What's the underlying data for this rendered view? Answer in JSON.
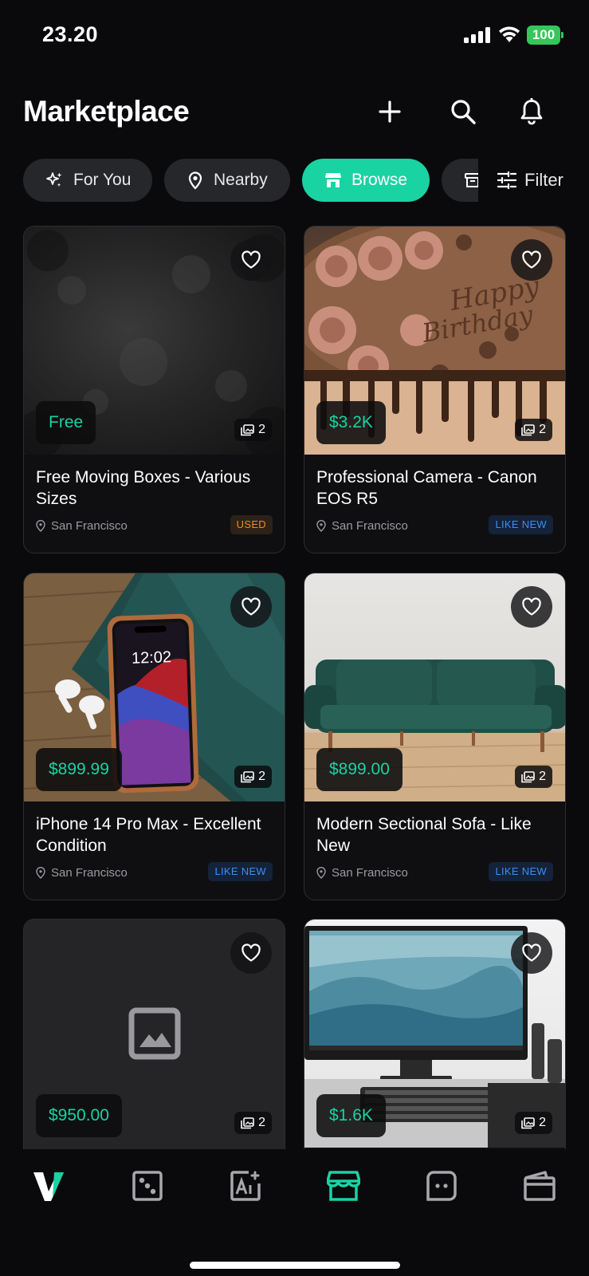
{
  "status_bar": {
    "time": "23.20",
    "battery": "100"
  },
  "header": {
    "title": "Marketplace"
  },
  "chips": [
    {
      "label": "For You",
      "icon": "sparkle-icon",
      "active": false
    },
    {
      "label": "Nearby",
      "icon": "location-pin-icon",
      "active": false
    },
    {
      "label": "Browse",
      "icon": "store-icon",
      "active": true
    }
  ],
  "filter": {
    "label": "Filter"
  },
  "listings": [
    {
      "price": "Free",
      "title": "Free Moving Boxes - Various Sizes",
      "location": "San Francisco",
      "condition": "USED",
      "image_count": "2",
      "image": "dark-texture"
    },
    {
      "price": "$3.2K",
      "title": "Professional Camera - Canon EOS R5",
      "location": "San Francisco",
      "condition": "LIKE NEW",
      "image_count": "2",
      "image": "birthday-cake"
    },
    {
      "price": "$899.99",
      "title": "iPhone 14 Pro Max - Excellent Condition",
      "location": "San Francisco",
      "condition": "LIKE NEW",
      "image_count": "2",
      "image": "iphone-on-table"
    },
    {
      "price": "$899.00",
      "title": "Modern Sectional Sofa - Like New",
      "location": "San Francisco",
      "condition": "LIKE NEW",
      "image_count": "2",
      "image": "green-sofa"
    },
    {
      "price": "$950.00",
      "image_count": "2",
      "image": "placeholder"
    },
    {
      "price": "$1.6K",
      "image_count": "2",
      "image": "desktop-monitor"
    }
  ],
  "bottom_nav": [
    {
      "icon": "brand-logo-icon",
      "active": false
    },
    {
      "icon": "dice-icon",
      "active": false
    },
    {
      "icon": "ai-text-icon",
      "active": false
    },
    {
      "icon": "store-icon",
      "active": true
    },
    {
      "icon": "chat-face-icon",
      "active": false
    },
    {
      "icon": "wallet-icon",
      "active": false
    }
  ],
  "colors": {
    "accent": "#19d3a3",
    "background": "#0a0a0c",
    "used": "#f08a24",
    "like_new": "#3d8ef0"
  }
}
